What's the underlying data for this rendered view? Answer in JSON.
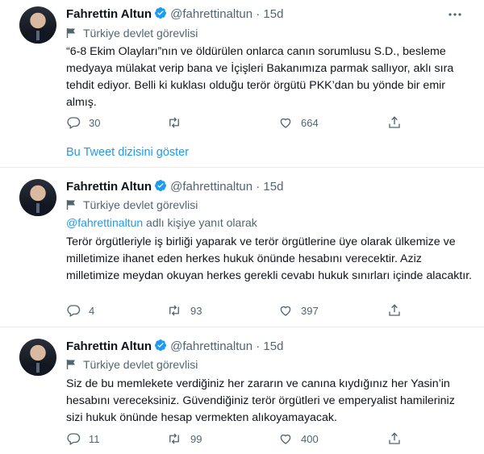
{
  "tweets": [
    {
      "name": "Fahrettin Altun",
      "handle": "@fahrettinaltun",
      "dot": "·",
      "time": "15d",
      "label": "Türkiye devlet görevlisi",
      "reply_to": null,
      "text": "“6-8 Ekim Olayları”nın ve öldürülen onlarca canın sorumlusu S.D., besleme medyaya mülakat verip bana ve İçişleri Bakanımıza parmak sallıyor, aklı sıra tehdit ediyor. Belli ki kuklası olduğu terör örgütü PKK’dan bu yönde bir emir almış.",
      "replies": "30",
      "retweets": "",
      "likes": "664"
    },
    {
      "name": "Fahrettin Altun",
      "handle": "@fahrettinaltun",
      "dot": "·",
      "time": "15d",
      "label": "Türkiye devlet görevlisi",
      "reply_to": {
        "mention": "@fahrettinaltun",
        "suffix": " adlı kişiye yanıt olarak"
      },
      "text": "Terör örgütleriyle iş birliği yaparak ve terör örgütlerine üye olarak ülkemize ve milletimize ihanet eden herkes hukuk önünde hesabını verecektir. Aziz milletimize meydan okuyan herkes gerekli cevabı hukuk sınırları içinde alacaktır.",
      "replies": "4",
      "retweets": "93",
      "likes": "397"
    },
    {
      "name": "Fahrettin Altun",
      "handle": "@fahrettinaltun",
      "dot": "·",
      "time": "15d",
      "label": "Türkiye devlet görevlisi",
      "reply_to": null,
      "text": "Siz de bu memlekete verdiğiniz her zararın ve canına kıydığınız her Yasin’in hesabını vereceksiniz. Güvendiğiniz terör örgütleri ve emperyalist hamileriniz sizi hukuk önünde hesap vermekten alıkoyamayacak.",
      "replies": "11",
      "retweets": "99",
      "likes": "400"
    }
  ],
  "thread_link": "Bu Tweet dizisini göster",
  "colors": {
    "accent": "#1d9bf0",
    "secondary_text": "#536471",
    "divider": "#e6ecf0"
  },
  "icons": [
    "verified-badge-icon",
    "flag-icon",
    "more-icon",
    "reply-icon",
    "retweet-icon",
    "like-icon",
    "share-icon"
  ]
}
